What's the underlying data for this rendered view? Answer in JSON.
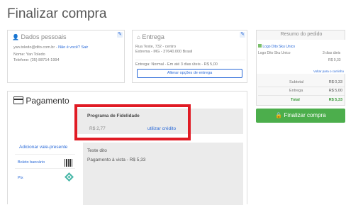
{
  "page": {
    "title": "Finalizar compra"
  },
  "personal": {
    "heading": "Dados pessoais",
    "email": "yan.toledo@dito.com.br",
    "not_you": "Não é você? Sair",
    "name_line": "Nome: Yan Toledo",
    "phone_line": "Telefone: (35) 88714-1994"
  },
  "delivery": {
    "heading": "Entrega",
    "address1": "Rua Teste, 732 - centro",
    "address2": "Extrema - MG - 37640.000 Brasil",
    "shipping": "Entrega: Normal - Em até 3 dias úteis - R$ 5,00",
    "change_button": "Alterar opções de entrega"
  },
  "summary": {
    "heading": "Resumo do pedido",
    "product_img_alt": "Logo Dito Sku Unico",
    "product_name": "Logo Dito Sku Unico",
    "product_delivery": "3 dias úteis",
    "product_price": "R$ 0,33",
    "back_link": "Voltar para o carrinho",
    "rows": [
      {
        "label": "Subtotal",
        "value": "R$ 0,33"
      },
      {
        "label": "Entrega",
        "value": "R$ 5,00"
      },
      {
        "label": "Total",
        "value": "R$ 5,33"
      }
    ]
  },
  "checkout_button": "Finalizar compra",
  "payment": {
    "heading": "Pagamento",
    "loyalty": {
      "title": "Programa de Fidelidade",
      "amount": "R$ 2,77",
      "use_credit": "utilizar crédito"
    },
    "add_voucher": "Adicionar vale-presente",
    "methods": [
      {
        "label": "Boleto bancário",
        "icon": "barcode-icon"
      },
      {
        "label": "Pix",
        "icon": "pix-icon"
      }
    ],
    "detail": {
      "title": "Teste dito",
      "installment": "Pagamento à vista - R$ 5,33"
    }
  },
  "colors": {
    "link": "#2a6ad8",
    "green": "#4cae4c",
    "highlight": "#e01b24"
  }
}
